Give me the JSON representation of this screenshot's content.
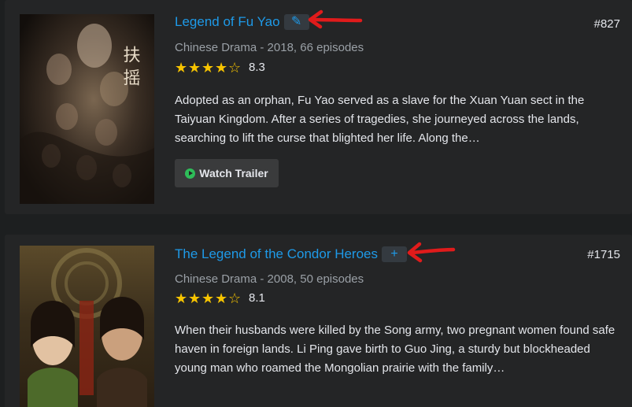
{
  "shows": [
    {
      "title": "Legend of Fu Yao",
      "action_icon": "pencil-icon",
      "action_glyph": "✎",
      "rank": "#827",
      "meta": "Chinese Drama - 2018, 66 episodes",
      "stars": 4,
      "rating": "8.3",
      "description": "Adopted as an orphan, Fu Yao served as a slave for the Xuan Yuan sect in the Taiyuan Kingdom. After a series of tragedies, she journeyed across the lands, searching to lift the curse that blighted her life. Along the…",
      "trailer_label": "Watch Trailer",
      "poster_text": "扶 摇"
    },
    {
      "title": "The Legend of the Condor Heroes",
      "action_icon": "plus-icon",
      "action_glyph": "+",
      "rank": "#1715",
      "meta": "Chinese Drama - 2008, 50 episodes",
      "stars": 4,
      "rating": "8.1",
      "description": "When their husbands were killed by the Song army, two pregnant women found safe haven in foreign lands. Li Ping gave birth to Guo Jing, a sturdy but blockheaded young man who roamed the Mongolian prairie with the family…"
    }
  ],
  "colors": {
    "link": "#1e9ae8",
    "star": "#f7c400",
    "play": "#2ebd59",
    "annotation_arrow": "#e01b1b"
  }
}
